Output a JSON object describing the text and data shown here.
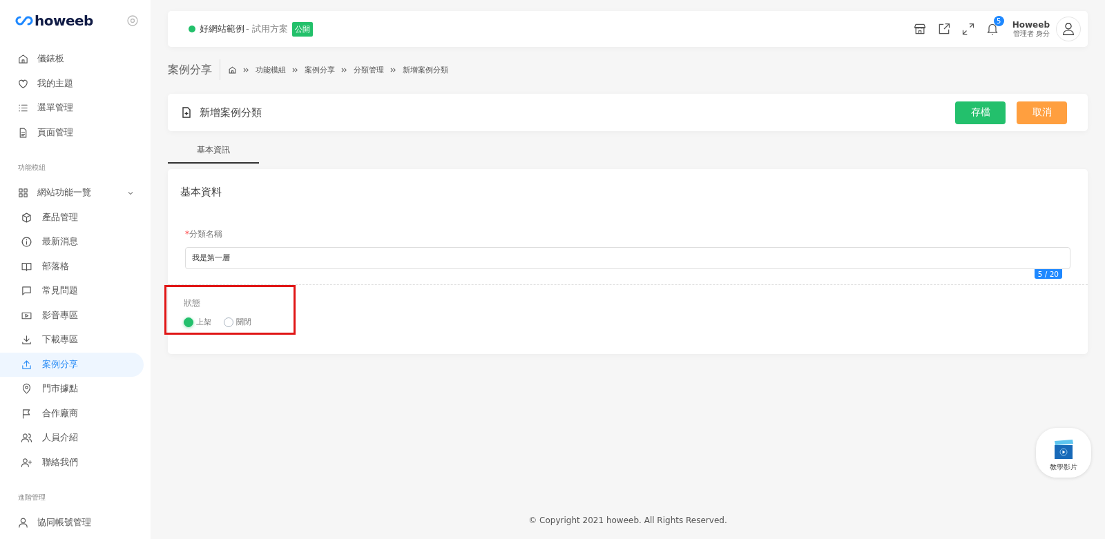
{
  "sidebar": {
    "logo": "howeeb",
    "sections": [
      {
        "items": [
          {
            "label": "儀錶板",
            "selected": false
          },
          {
            "label": "我的主題",
            "selected": false
          },
          {
            "label": "選單管理",
            "selected": false
          },
          {
            "label": "頁面管理",
            "selected": false
          }
        ]
      },
      {
        "label": "功能模組",
        "items": [
          {
            "label": "網站功能一覽",
            "selected": false,
            "expanded": true,
            "children": [
              {
                "label": "產品管理",
                "selected": false
              },
              {
                "label": "最新消息",
                "selected": false
              },
              {
                "label": "部落格",
                "selected": false
              },
              {
                "label": "常見問題",
                "selected": false
              },
              {
                "label": "影音專區",
                "selected": false
              },
              {
                "label": "下載專區",
                "selected": false
              },
              {
                "label": "案例分享",
                "selected": true
              },
              {
                "label": "門市據點",
                "selected": false
              },
              {
                "label": "合作廠商",
                "selected": false
              },
              {
                "label": "人員介紹",
                "selected": false
              },
              {
                "label": "聯絡我們",
                "selected": false
              }
            ]
          }
        ]
      },
      {
        "label": "進階管理",
        "items": [
          {
            "label": "協同帳號管理",
            "selected": false
          }
        ]
      }
    ]
  },
  "topbar": {
    "site": {
      "name": "好網站範例",
      "plan": "- 試用方案",
      "badge": "公開"
    },
    "notifications": "5",
    "user": {
      "name": "Howeeb",
      "role": "管理者 身分"
    }
  },
  "breadcrumb": {
    "title": "案例分享",
    "crumbs": [
      "功能模組",
      "案例分享",
      "分類管理",
      "新增案例分類"
    ]
  },
  "header": {
    "title": "新增案例分類",
    "buttons": [
      {
        "label": "存檔",
        "kind": "primary"
      },
      {
        "label": "取消",
        "kind": "warning"
      }
    ]
  },
  "tabs": [
    {
      "label": "基本資訊",
      "selected": true
    }
  ],
  "form": {
    "section_title": "基本資料",
    "field": {
      "required_mark": "*",
      "label": "分類名稱",
      "value": "我是第一層",
      "counter": "5 / 20"
    },
    "status": {
      "label": "狀態",
      "highlighted": true,
      "options": [
        {
          "label": "上架",
          "selected": true
        },
        {
          "label": "關閉",
          "selected": false
        }
      ]
    }
  },
  "footer": "© Copyright 2021 howeeb. All Rights Reserved.",
  "help_video": {
    "label": "教學影片"
  }
}
